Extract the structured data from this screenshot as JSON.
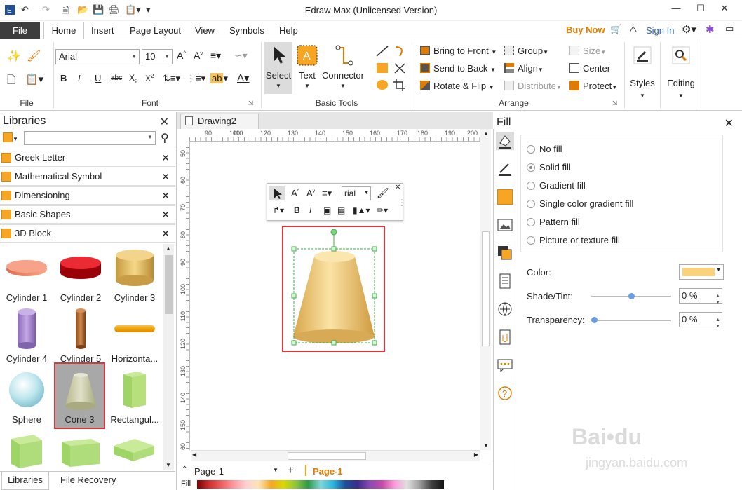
{
  "window": {
    "title": "Edraw Max (Unlicensed Version)",
    "controls": [
      "minimize",
      "maximize",
      "close"
    ]
  },
  "menu": {
    "file": "File",
    "tabs": [
      "Home",
      "Insert",
      "Page Layout",
      "View",
      "Symbols",
      "Help"
    ],
    "buy_now": "Buy Now",
    "sign_in": "Sign In"
  },
  "ribbon": {
    "groups": {
      "file": "File",
      "font": "Font",
      "basic_tools": "Basic Tools",
      "arrange": "Arrange"
    },
    "font_name": "Arial",
    "font_size": "10",
    "basic_tools": {
      "select": "Select",
      "text": "Text",
      "connector": "Connector"
    },
    "arrange": {
      "bring_to_front": "Bring to Front",
      "send_to_back": "Send to Back",
      "rotate_flip": "Rotate & Flip",
      "group": "Group",
      "align": "Align",
      "distribute": "Distribute",
      "size": "Size",
      "center": "Center",
      "protect": "Protect"
    },
    "styles": "Styles",
    "editing": "Editing"
  },
  "libraries": {
    "header": "Libraries",
    "search_placeholder": "",
    "categories": [
      "Greek Letter",
      "Mathematical Symbol",
      "Dimensioning",
      "Basic Shapes",
      "3D Block"
    ],
    "shapes": [
      "Cylinder 1",
      "Cylinder 2",
      "Cylinder 3",
      "Cylinder 4",
      "Cylinder 5",
      "Horizonta...",
      "Sphere",
      "Cone 3",
      "Rectangul..."
    ],
    "selected_shape": "Cone 3",
    "bottom_tabs": [
      "Libraries",
      "File Recovery"
    ]
  },
  "document": {
    "tab": "Drawing2",
    "ruler_top": [
      "90",
      "100",
      "110",
      "120",
      "130",
      "140",
      "150",
      "160",
      "170",
      "180",
      "190",
      "200"
    ],
    "ruler_left": [
      "50",
      "60",
      "70",
      "80",
      "90",
      "100",
      "110",
      "120",
      "130",
      "140",
      "150",
      "160"
    ],
    "float_font": "rial",
    "page_tab": "Page-1",
    "page_active": "Page-1",
    "fill_label": "Fill"
  },
  "fill_panel": {
    "title": "Fill",
    "options": [
      "No fill",
      "Solid fill",
      "Gradient fill",
      "Single color gradient fill",
      "Pattern fill",
      "Picture or texture fill"
    ],
    "selected_option": "Solid fill",
    "color_label": "Color:",
    "color_value": "#f9d27b",
    "shade_label": "Shade/Tint:",
    "shade_value": "0 %",
    "transparency_label": "Transparency:",
    "transparency_value": "0 %"
  },
  "colors": {
    "accent_orange": "#e07b00",
    "highlight_red": "#d9363e",
    "selection_green": "#3fae49",
    "file_tab_bg": "#3e3e3e"
  }
}
